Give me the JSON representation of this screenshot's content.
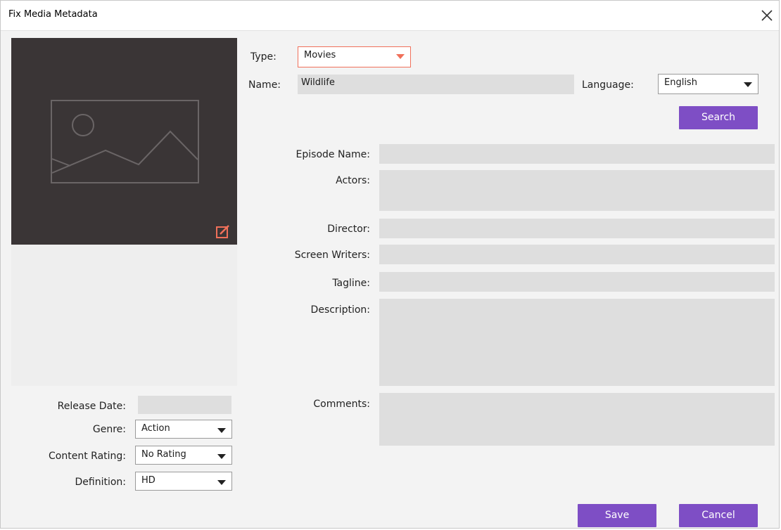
{
  "window": {
    "title": "Fix Media Metadata"
  },
  "type": {
    "label": "Type:",
    "value": "Movies"
  },
  "name": {
    "label": "Name:",
    "value": "Wildlife"
  },
  "language": {
    "label": "Language:",
    "value": "English"
  },
  "search_button": "Search",
  "fields": {
    "episode_name": "Episode Name:",
    "actors": "Actors:",
    "director": "Director:",
    "screen_writers": "Screen Writers:",
    "tagline": "Tagline:",
    "description": "Description:",
    "comments": "Comments:"
  },
  "left": {
    "release_date": {
      "label": "Release Date:",
      "value": ""
    },
    "genre": {
      "label": "Genre:",
      "value": "Action"
    },
    "content_rating": {
      "label": "Content Rating:",
      "value": "No Rating"
    },
    "definition": {
      "label": "Definition:",
      "value": "HD"
    }
  },
  "buttons": {
    "save": "Save",
    "cancel": "Cancel"
  },
  "colors": {
    "accent": "#7e4ec5",
    "type_border": "#f0705a",
    "edit_icon": "#f0705a"
  }
}
